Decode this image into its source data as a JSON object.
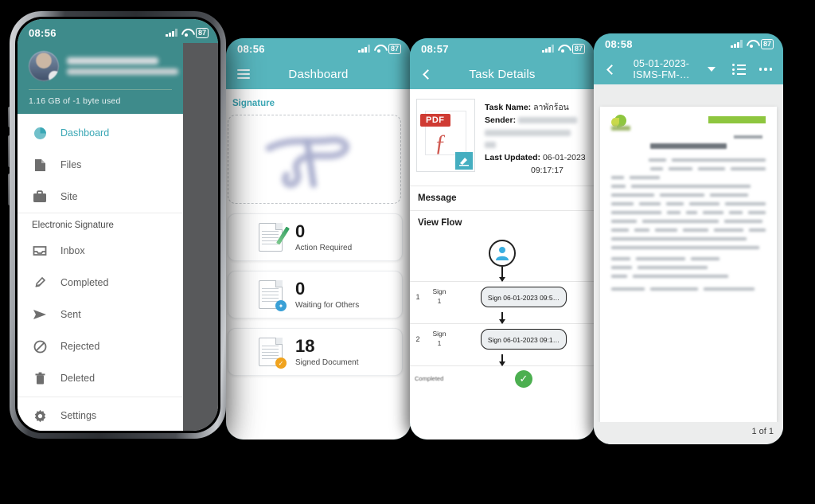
{
  "app": {
    "accent_teal": "#57b5bd",
    "drawer_teal": "#3e8b8b",
    "fab_orange": "#f5a623",
    "green": "#4caf50"
  },
  "phone1": {
    "statusbar": {
      "time": "08:56",
      "battery": "87"
    },
    "drawer": {
      "storage_usage": "1.16 GB of -1 byte used",
      "items": [
        {
          "label": "Dashboard",
          "icon": "pie-chart-icon",
          "active": true
        },
        {
          "label": "Files",
          "icon": "file-icon",
          "active": false
        },
        {
          "label": "Site",
          "icon": "briefcase-icon",
          "active": false
        }
      ],
      "section_label": "Electronic Signature",
      "esig_items": [
        {
          "label": "Inbox",
          "icon": "inbox-icon"
        },
        {
          "label": "Completed",
          "icon": "signed-doc-icon"
        },
        {
          "label": "Sent",
          "icon": "send-icon"
        },
        {
          "label": "Rejected",
          "icon": "block-icon"
        },
        {
          "label": "Deleted",
          "icon": "trash-icon"
        }
      ],
      "settings": {
        "label": "Settings",
        "icon": "gear-icon"
      }
    }
  },
  "phone2": {
    "statusbar": {
      "time": "08:56",
      "battery": "87"
    },
    "appbar": {
      "title": "Dashboard",
      "menu_icon": "hamburger-icon"
    },
    "signature_section_label": "Signature",
    "stats": [
      {
        "value": "0",
        "label": "Action Required",
        "icon": "document-pen-icon"
      },
      {
        "value": "0",
        "label": "Waiting for Others",
        "icon": "document-seal-icon"
      },
      {
        "value": "18",
        "label": "Signed Document",
        "icon": "document-check-icon"
      }
    ]
  },
  "phone3": {
    "statusbar": {
      "time": "08:57",
      "battery": "87"
    },
    "appbar": {
      "title": "Task Details",
      "back_icon": "chevron-left-icon"
    },
    "file_icon": {
      "type": "pdf-file-icon",
      "label": "PDF"
    },
    "fields": {
      "task_name_label": "Task Name:",
      "task_name_value": "ลาพักร้อน",
      "sender_label": "Sender:",
      "last_updated_label": "Last Updated:",
      "last_updated_value": "06-01-2023",
      "last_updated_time": "09:17:17"
    },
    "sections": {
      "message": "Message",
      "view_flow": "View Flow"
    },
    "flow": [
      {
        "num": "1",
        "action": "Sign",
        "action_num": "1",
        "date": "Sign 06-01-2023 09:5…"
      },
      {
        "num": "2",
        "action": "Sign",
        "action_num": "1",
        "date": "Sign 06-01-2023 09:1…"
      }
    ],
    "flow_end_label": "Completed"
  },
  "phone4": {
    "statusbar": {
      "time": "08:58",
      "battery": "87"
    },
    "appbar": {
      "title": "05-01-2023-ISMS-FM-…",
      "back_icon": "chevron-left-icon",
      "dropdown_icon": "caret-down-icon",
      "outline_icon": "list-outline-icon",
      "more_icon": "more-horizontal-icon"
    },
    "page_indicator": "1 of 1",
    "fab_label": "+"
  }
}
